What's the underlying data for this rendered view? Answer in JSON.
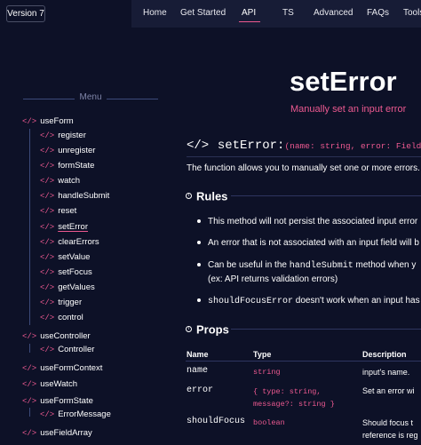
{
  "version_badge": "Version 7",
  "nav": {
    "items": [
      "Home",
      "Get Started",
      "API",
      "TS",
      "Advanced",
      "FAQs",
      "Tools"
    ],
    "active": "API"
  },
  "sidebar": {
    "title": "Menu",
    "code_tag": "</>",
    "groups": [
      {
        "label": "useForm",
        "children": [
          "register",
          "unregister",
          "formState",
          "watch",
          "handleSubmit",
          "reset",
          "setError",
          "clearErrors",
          "setValue",
          "setFocus",
          "getValues",
          "trigger",
          "control"
        ]
      },
      {
        "label": "useController",
        "children": [
          "Controller"
        ]
      },
      {
        "label": "useFormContext",
        "children": []
      },
      {
        "label": "useWatch",
        "children": []
      },
      {
        "label": "useFormState",
        "children": [
          "ErrorMessage"
        ]
      },
      {
        "label": "useFieldArray",
        "children": []
      }
    ],
    "active_item": "setError"
  },
  "main": {
    "title": "setError",
    "subtitle": "Manually set an input error",
    "signature": {
      "code_tag": "</>",
      "name": "setError:",
      "params": "(name: string, error: FieldError"
    },
    "intro": "The function allows you to manually set one or more errors.",
    "rules": {
      "heading": "Rules",
      "items": [
        {
          "text": "This method will not persist the associated input error"
        },
        {
          "text": "An error that is not associated with an input field will b"
        },
        {
          "pre": "Can be useful in the ",
          "code": "handleSubmit",
          "post": " method when y",
          "cont": "(ex: API returns validation errors)"
        },
        {
          "code": "shouldFocusError",
          "post": " doesn't work when an input has"
        }
      ]
    },
    "props": {
      "heading": "Props",
      "columns": [
        "Name",
        "Type",
        "Description"
      ],
      "rows": [
        {
          "name": "name",
          "type": [
            "string"
          ],
          "desc": [
            "input's name."
          ]
        },
        {
          "name": "error",
          "type": [
            "{ type: string,",
            "message?: string }"
          ],
          "desc": [
            "Set an error wi"
          ]
        },
        {
          "name": "shouldFocus",
          "type": [
            "boolean"
          ],
          "desc": [
            "Should focus t",
            "reference is reg"
          ]
        }
      ]
    }
  },
  "colors": {
    "background": "#0d1127",
    "nav_background": "#171c36",
    "accent": "#ec5990",
    "text": "#ffffff",
    "muted": "#7f85a8"
  }
}
